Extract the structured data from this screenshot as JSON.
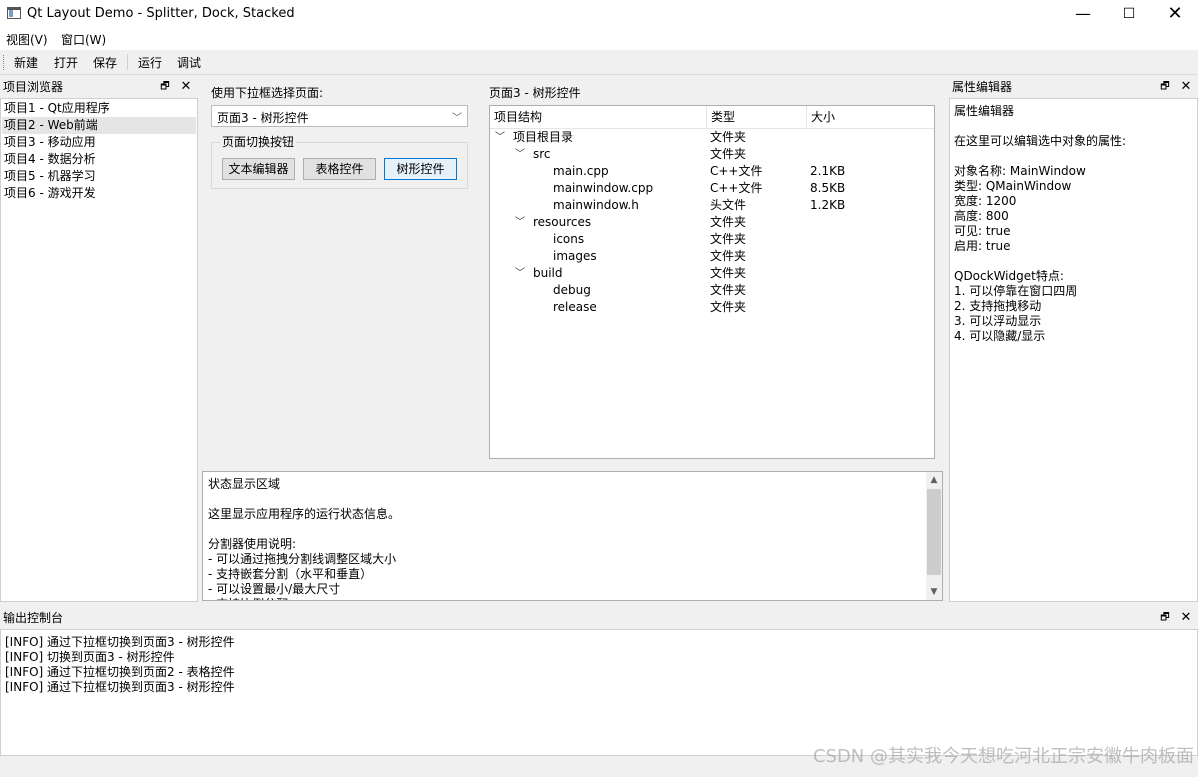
{
  "window": {
    "title": "Qt Layout Demo - Splitter, Dock, Stacked",
    "minimize": "—",
    "maximize": "☐",
    "close": "✕"
  },
  "menu": {
    "view": "视图(V)",
    "window": "窗口(W)"
  },
  "toolbar": {
    "new": "新建",
    "open": "打开",
    "save": "保存",
    "run": "运行",
    "debug": "调试"
  },
  "left_dock": {
    "title": "项目浏览器",
    "float_icon": "🗗",
    "close_icon": "✕",
    "items": [
      "项目1 - Qt应用程序",
      "项目2 - Web前端",
      "项目3 - 移动应用",
      "项目4 - 数据分析",
      "项目5 - 机器学习",
      "项目6 - 游戏开发"
    ]
  },
  "center": {
    "select_label": "使用下拉框选择页面:",
    "select_value": "页面3 - 树形控件",
    "select_arrow": "﹀",
    "group_title": "页面切换按钮",
    "buttons": {
      "text_editor": "文本编辑器",
      "table": "表格控件",
      "tree": "树形控件"
    },
    "page_title": "页面3 - 树形控件",
    "tree": {
      "headers": {
        "structure": "项目结构",
        "type": "类型",
        "size": "大小"
      },
      "rows": [
        {
          "name": "项目根目录",
          "type": "文件夹",
          "size": "",
          "chev": "﹀"
        },
        {
          "name": "src",
          "type": "文件夹",
          "size": "",
          "chev": "﹀"
        },
        {
          "name": "main.cpp",
          "type": "C++文件",
          "size": "2.1KB",
          "chev": ""
        },
        {
          "name": "mainwindow.cpp",
          "type": "C++文件",
          "size": "8.5KB",
          "chev": ""
        },
        {
          "name": "mainwindow.h",
          "type": "头文件",
          "size": "1.2KB",
          "chev": ""
        },
        {
          "name": "resources",
          "type": "文件夹",
          "size": "",
          "chev": "﹀"
        },
        {
          "name": "icons",
          "type": "文件夹",
          "size": "",
          "chev": ""
        },
        {
          "name": "images",
          "type": "文件夹",
          "size": "",
          "chev": ""
        },
        {
          "name": "build",
          "type": "文件夹",
          "size": "",
          "chev": "﹀"
        },
        {
          "name": "debug",
          "type": "文件夹",
          "size": "",
          "chev": ""
        },
        {
          "name": "release",
          "type": "文件夹",
          "size": "",
          "chev": ""
        }
      ]
    },
    "status": {
      "text": "状态显示区域\n\n这里显示应用程序的运行状态信息。\n\n分割器使用说明:\n- 可以通过拖拽分割线调整区域大小\n- 支持嵌套分割（水平和垂直）\n- 可以设置最小/最大尺寸\n- 支持比例分配",
      "scroll_up": "▲",
      "scroll_down": "▼"
    }
  },
  "right_dock": {
    "title": "属性编辑器",
    "float_icon": "🗗",
    "close_icon": "✕",
    "text": "属性编辑器\n\n在这里可以编辑选中对象的属性:\n\n对象名称: MainWindow\n类型: QMainWindow\n宽度: 1200\n高度: 800\n可见: true\n启用: true\n\nQDockWidget特点:\n1. 可以停靠在窗口四周\n2. 支持拖拽移动\n3. 可以浮动显示\n4. 可以隐藏/显示"
  },
  "bottom_dock": {
    "title": "输出控制台",
    "float_icon": "🗗",
    "close_icon": "✕",
    "text": "[INFO] 通过下拉框切换到页面3 - 树形控件\n[INFO] 切换到页面3 - 树形控件\n[INFO] 通过下拉框切换到页面2 - 表格控件\n[INFO] 通过下拉框切换到页面3 - 树形控件"
  },
  "watermark": "CSDN @其实我今天想吃河北正宗安徽牛肉板面"
}
